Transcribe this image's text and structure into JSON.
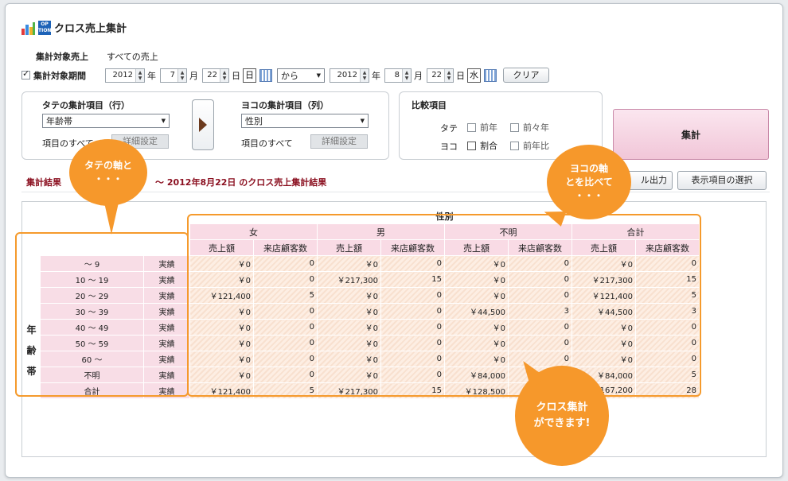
{
  "app": {
    "title": "クロス売上集計",
    "logo_text": "OP TION"
  },
  "filter": {
    "target_label": "集計対象売上",
    "target_value": "すべての売上",
    "period_label": "集計対象期間",
    "period_checked": true,
    "start": {
      "year": "2012",
      "year_unit": "年",
      "month": "7",
      "month_unit": "月",
      "day": "22",
      "day_unit": "日",
      "dow": "日"
    },
    "range_select": "から",
    "end": {
      "year": "2012",
      "year_unit": "年",
      "month": "8",
      "month_unit": "月",
      "day": "22",
      "day_unit": "日",
      "dow": "水"
    },
    "clear_button": "クリア"
  },
  "axes": {
    "row_title": "タテの集計項目（行）",
    "row_select": "年齢帯",
    "row_all": "項目のすべて",
    "row_detail_button": "詳細設定",
    "col_title": "ヨコの集計項目（列）",
    "col_select": "性別",
    "col_all": "項目のすべて",
    "col_detail_button": "詳細設定"
  },
  "compare": {
    "title": "比較項目",
    "tate_label": "タテ",
    "yoko_label": "ヨコ",
    "prev_year": "前年",
    "prev_prev_year": "前々年",
    "ratio": "割合",
    "yoy": "前年比"
  },
  "aggregate_button": "集計",
  "results": {
    "title_start": "集計結果",
    "title_end": "～ 2012年8月22日 のクロス売上集計結果",
    "export_button": "ル出力",
    "select_items_button": "表示項目の選択"
  },
  "table": {
    "col_group_title": "性別",
    "row_group_title": [
      "年",
      "齢",
      "帯"
    ],
    "groups": [
      "女",
      "男",
      "不明",
      "合計"
    ],
    "metrics": [
      "売上額",
      "来店顧客数"
    ],
    "rows": [
      {
        "label": "～ 9",
        "type": "実績",
        "cells": [
          "￥0",
          "0",
          "￥0",
          "0",
          "￥0",
          "0",
          "￥0",
          "0"
        ]
      },
      {
        "label": "10 ～ 19",
        "type": "実績",
        "cells": [
          "￥0",
          "0",
          "￥217,300",
          "15",
          "￥0",
          "0",
          "￥217,300",
          "15"
        ]
      },
      {
        "label": "20 ～ 29",
        "type": "実績",
        "cells": [
          "￥121,400",
          "5",
          "￥0",
          "0",
          "￥0",
          "0",
          "￥121,400",
          "5"
        ]
      },
      {
        "label": "30 ～ 39",
        "type": "実績",
        "cells": [
          "￥0",
          "0",
          "￥0",
          "0",
          "￥44,500",
          "3",
          "￥44,500",
          "3"
        ]
      },
      {
        "label": "40 ～ 49",
        "type": "実績",
        "cells": [
          "￥0",
          "0",
          "￥0",
          "0",
          "￥0",
          "0",
          "￥0",
          "0"
        ]
      },
      {
        "label": "50 ～ 59",
        "type": "実績",
        "cells": [
          "￥0",
          "0",
          "￥0",
          "0",
          "￥0",
          "0",
          "￥0",
          "0"
        ]
      },
      {
        "label": "60 ～",
        "type": "実績",
        "cells": [
          "￥0",
          "0",
          "￥0",
          "0",
          "￥0",
          "0",
          "￥0",
          "0"
        ]
      },
      {
        "label": "不明",
        "type": "実績",
        "cells": [
          "￥0",
          "0",
          "￥0",
          "0",
          "￥84,000",
          "",
          "￥84,000",
          "5"
        ]
      },
      {
        "label": "合計",
        "type": "実績",
        "cells": [
          "￥121,400",
          "5",
          "￥217,300",
          "15",
          "￥128,500",
          "",
          "167,200",
          "28"
        ]
      }
    ]
  },
  "callouts": {
    "tate": [
      "タテの軸と",
      "・・・"
    ],
    "yoko": [
      "ヨコの軸",
      "とを比べて",
      "・・・"
    ],
    "cross": [
      "クロス集計",
      "ができます!"
    ]
  },
  "colors": {
    "accent_orange": "#f6982b",
    "pink_header": "#f9dbe5",
    "result_title": "#8b1020"
  }
}
